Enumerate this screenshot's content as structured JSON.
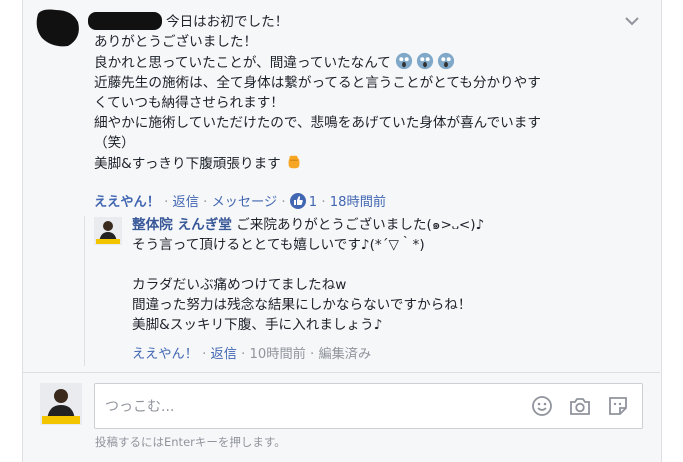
{
  "colors": {
    "link": "#4267b2",
    "meta": "#90949c",
    "text": "#1d2129"
  },
  "comment": {
    "heading_text": "今日はお初でした！",
    "lines": [
      "ありがとうございました！",
      "良かれと思っていたことが、間違っていたなんて",
      "近藤先生の施術は、全て身体は繋がってると言うことがとても分かりやす",
      "くていつも納得させられます！",
      "細やかに施術していただけたので、悲鳴をあげていた身体が喜んでいます",
      "（笑）",
      "美脚&すっきり下腹頑張ります"
    ],
    "emoji_line2": [
      "scream-emoji",
      "scream-emoji",
      "scream-emoji"
    ],
    "emoji_line7": "fist-emoji",
    "actions": {
      "like": "ええやん！",
      "reply": "返信",
      "message": "メッセージ",
      "like_count": "1",
      "time": "18時間前"
    }
  },
  "reply": {
    "author": "整体院 えんぎ堂",
    "lines": [
      "ご来院ありがとうございました(๑>᎑<)♪",
      "そう言って頂けるととても嬉しいです♪(*´▽｀*)",
      "",
      "カラダだいぶ痛めつけてましたねw",
      "間違った努力は残念な結果にしかならないですからね！",
      "美脚&スッキリ下腹、手に入れましょう♪"
    ],
    "actions": {
      "like": "ええやん！",
      "reply": "返信",
      "time": "10時間前",
      "edited": "編集済み"
    }
  },
  "composer": {
    "placeholder": "つっこむ...",
    "hint": "投稿するにはEnterキーを押します。",
    "icons": [
      "emoji-icon",
      "camera-icon",
      "sticker-icon"
    ]
  }
}
